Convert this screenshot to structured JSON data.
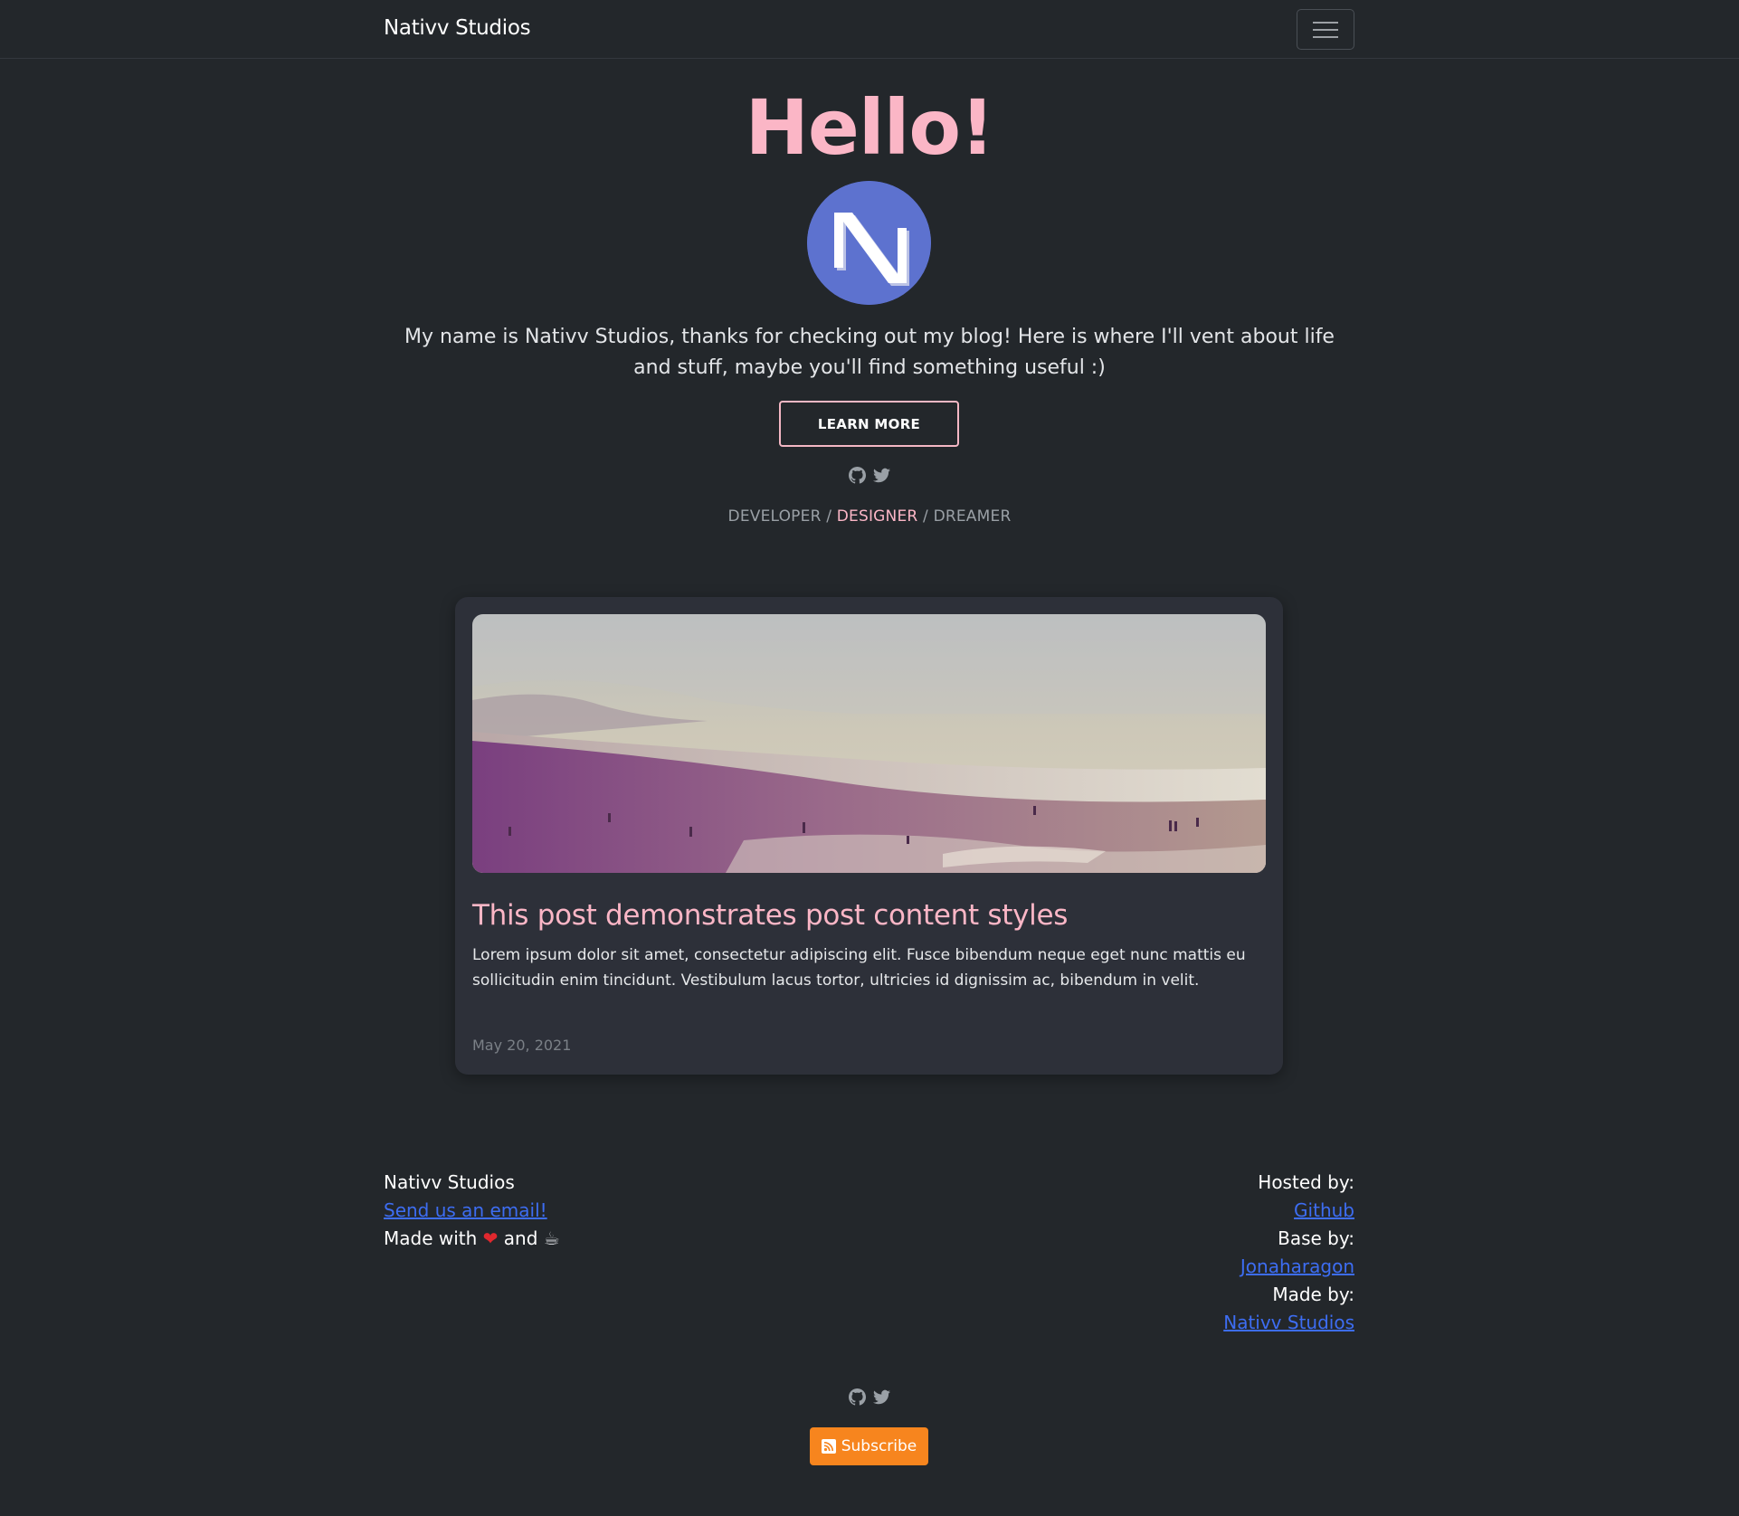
{
  "navbar": {
    "brand": "Nativv Studios",
    "menu_icon": "hamburger-menu-icon"
  },
  "hero": {
    "title": "Hello!",
    "avatar_icon": "nativv-logo-icon",
    "intro": "My name is Nativv Studios, thanks for checking out my blog! Here is where I'll vent about life and stuff, maybe you'll find something useful :)",
    "learn_more": "LEARN MORE",
    "social_icons": [
      "github-icon",
      "twitter-icon"
    ],
    "roles": {
      "first": "DEVELOPER",
      "sep1": " / ",
      "second": "DESIGNER",
      "sep2": " / ",
      "third": "DREAMER"
    }
  },
  "post": {
    "image_icon": "beach-photo",
    "title": "This post demonstrates post content styles",
    "excerpt": "Lorem ipsum dolor sit amet, consectetur adipiscing elit. Fusce bibendum neque eget nunc mattis eu sollicitudin enim tincidunt. Vestibulum lacus tortor, ultricies id dignissim ac, bibendum in velit.",
    "date": "May 20, 2021"
  },
  "footer": {
    "left": {
      "name": "Nativv Studios",
      "email_link": "Send us an email!",
      "made_with_prefix": "Made with",
      "heart": "❤",
      "and": "and",
      "cup": "☕"
    },
    "right": {
      "hosted_label": "Hosted by:",
      "hosted_link": "Github",
      "base_label": "Base by:",
      "base_link": "Jonaharagon",
      "made_label": "Made by:",
      "made_link": "Nativv Studios"
    },
    "subscribe_label": "Subscribe",
    "subscribe_color": "#f7851e"
  },
  "colors": {
    "background": "#23272b",
    "accent_pink": "#fbb6c6",
    "avatar_blue": "#5d72cf",
    "link_blue": "#3d6df2",
    "card_bg": "#2d3039"
  }
}
